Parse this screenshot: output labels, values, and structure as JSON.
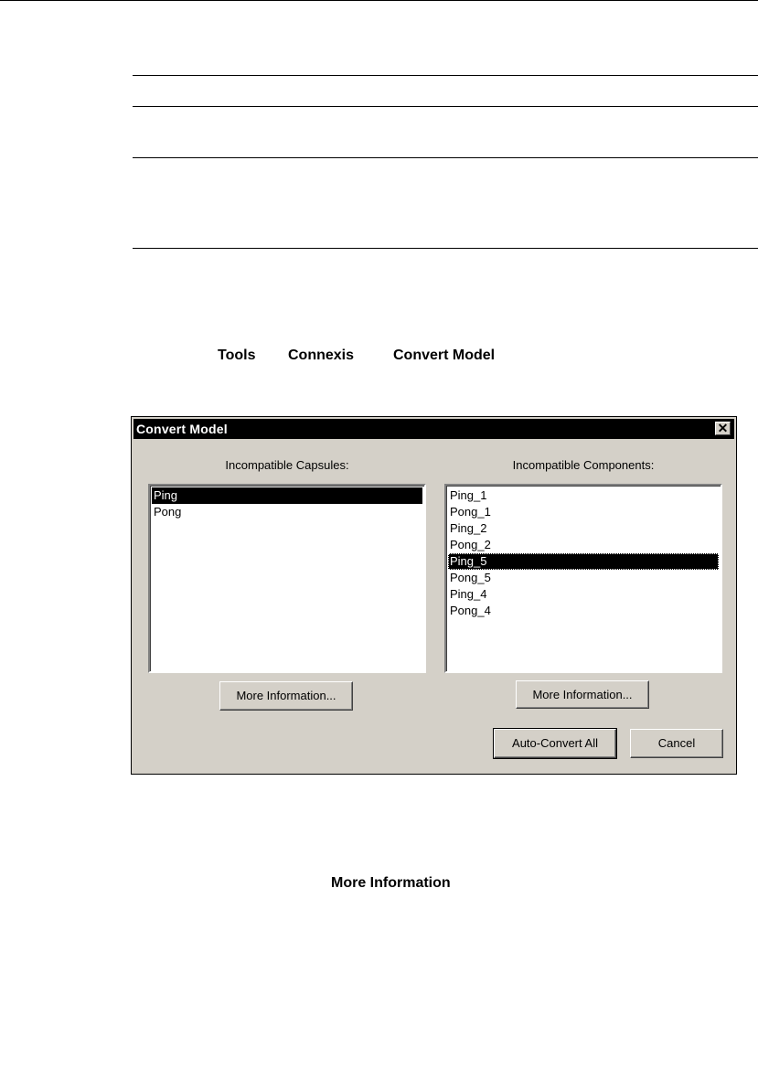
{
  "menu_path": {
    "tools": "Tools",
    "connexis": "Connexis",
    "convert_model": "Convert Model"
  },
  "dialog": {
    "title": "Convert Model",
    "close_glyph": "✕",
    "left_panel": {
      "label": "Incompatible Capsules:",
      "items": [
        "Ping",
        "Pong"
      ],
      "selected_index": 0,
      "button_label": "More Information..."
    },
    "right_panel": {
      "label": "Incompatible Components:",
      "items": [
        "Ping_1",
        "Pong_1",
        "Ping_2",
        "Pong_2",
        "Ping_5",
        "Pong_5",
        "Ping_4",
        "Pong_4"
      ],
      "selected_index": 4,
      "button_label": "More Information..."
    },
    "auto_convert_label": "Auto-Convert All",
    "cancel_label": "Cancel"
  },
  "more_information_text": "More Information"
}
